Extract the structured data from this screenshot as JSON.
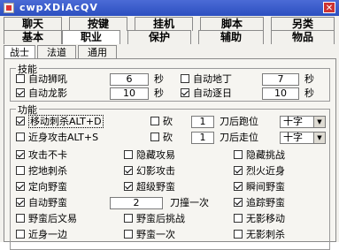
{
  "window": {
    "title": "cwpXDiAcQV"
  },
  "tabs_row1": [
    "聊天",
    "按键",
    "挂机",
    "脚本",
    "另类"
  ],
  "tabs_row2": [
    "基本",
    "职业",
    "保护",
    "辅助",
    "物品"
  ],
  "tabs_row3": [
    "战士",
    "法道",
    "通用"
  ],
  "skills": {
    "legend": "技能",
    "auto_shout": {
      "label": "自动狮吼",
      "value": "6",
      "unit": "秒",
      "checked": false
    },
    "auto_dizhen": {
      "label": "自动地丁",
      "value": "7",
      "unit": "秒",
      "checked": false
    },
    "auto_dragon": {
      "label": "自动龙影",
      "value": "10",
      "unit": "秒",
      "checked": true
    },
    "auto_nrz": {
      "label": "自动逐日",
      "value": "10",
      "unit": "秒",
      "checked": true
    }
  },
  "functions": {
    "legend": "功能",
    "move_stab": {
      "label": "移动刺杀ALT+D",
      "checked": true
    },
    "melee_attack": {
      "label": "近身攻击ALT+S",
      "checked": false
    },
    "chop1": {
      "label": "砍",
      "value": "1",
      "suffix": "刀后跑位",
      "dropdown": "十字",
      "checked": false
    },
    "chop2": {
      "label": "砍",
      "value": "1",
      "suffix": "刀后走位",
      "dropdown": "十字",
      "checked": false
    },
    "rows": [
      [
        {
          "label": "攻击不卡",
          "checked": true
        },
        {
          "label": "隐藏攻易",
          "checked": false
        },
        {
          "label": "隐藏挑战",
          "checked": false
        }
      ],
      [
        {
          "label": "挖地刺杀",
          "checked": false
        },
        {
          "label": "幻影攻击",
          "checked": true
        },
        {
          "label": "烈火近身",
          "checked": true
        }
      ],
      [
        {
          "label": "定向野蛮",
          "checked": true
        },
        {
          "label": "超级野蛮",
          "checked": true
        },
        {
          "label": "瞬间野蛮",
          "checked": true
        }
      ]
    ],
    "auto_barbarian": {
      "label": "自动野蛮",
      "value": "2",
      "suffix": "刀撞一次",
      "checked": true
    },
    "chase_barbarian": {
      "label": "追踪野蛮",
      "checked": true
    },
    "row_b": [
      {
        "label": "野蛮后文易",
        "checked": false
      },
      {
        "label": "野蛮后挑战",
        "checked": false
      },
      {
        "label": "无影移动",
        "checked": false
      }
    ],
    "row_c": [
      {
        "label": "近身一边",
        "checked": false
      },
      {
        "label": "野蛮一次",
        "checked": false
      },
      {
        "label": "无影刺杀",
        "checked": false
      }
    ]
  }
}
